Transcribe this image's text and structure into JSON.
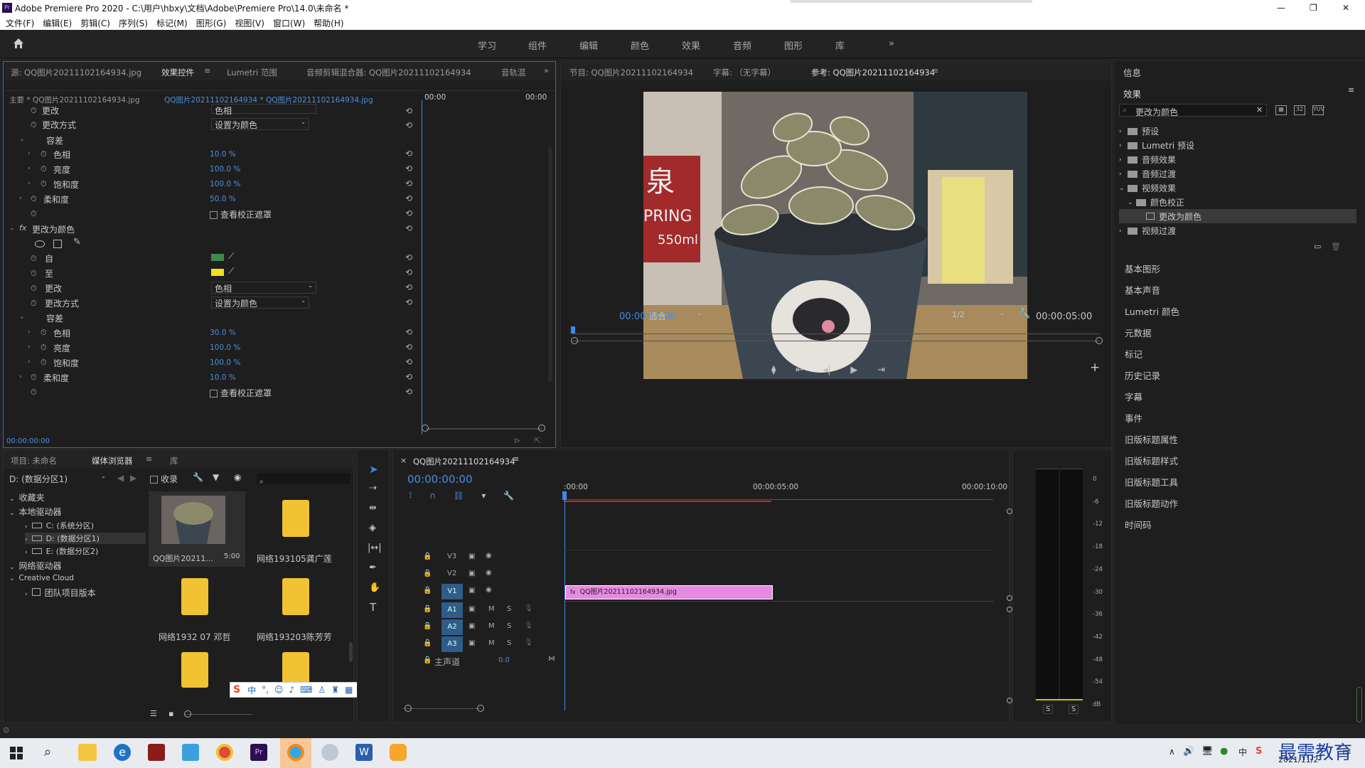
{
  "window": {
    "title": "Adobe Premiere Pro 2020 - C:\\用户\\hbxy\\文档\\Adobe\\Premiere Pro\\14.0\\未命名 *",
    "minimize": "—",
    "restore": "❐",
    "close": "✕"
  },
  "menu": [
    "文件(F)",
    "编辑(E)",
    "剪辑(C)",
    "序列(S)",
    "标记(M)",
    "图形(G)",
    "视图(V)",
    "窗口(W)",
    "帮助(H)"
  ],
  "workspaces": [
    "学习",
    "组件",
    "编辑",
    "颜色",
    "效果",
    "音频",
    "图形",
    "库"
  ],
  "workspace_more": "»",
  "effect_controls": {
    "tabs": [
      "源: QQ图片20211102164934.jpg",
      "效果控件",
      "Lumetri 范围",
      "音频剪辑混合器: QQ图片20211102164934",
      "音轨混"
    ],
    "master_label": "主要 * QQ图片20211102164934.jpg",
    "clip_label": "QQ图片20211102164934 * QQ图片20211102164934.jpg",
    "tl_start": "00:00",
    "tl_end": "00:00",
    "rows1": {
      "change_label": "更改",
      "change_value": "色相",
      "change_by_label": "更改方式",
      "change_by_value": "设置为颜色",
      "tolerance_label": "容差",
      "hue_label": "色相",
      "hue_value": "10.0 %",
      "lightness_label": "亮度",
      "lightness_value": "100.0 %",
      "saturation_label": "饱和度",
      "saturation_value": "100.0 %",
      "softness_label": "柔和度",
      "softness_value": "50.0 %",
      "mask_label": "查看校正遮罩"
    },
    "effect2_name": "更改为颜色",
    "rows2": {
      "from_label": "自",
      "to_label": "至",
      "change_label": "更改",
      "change_value": "色相",
      "change_by_label": "更改方式",
      "change_by_value": "设置为颜色",
      "tolerance_label": "容差",
      "hue_label": "色相",
      "hue_value": "30.0 %",
      "lightness_label": "亮度",
      "lightness_value": "100.0 %",
      "saturation_label": "饱和度",
      "saturation_value": "100.0 %",
      "softness_label": "柔和度",
      "softness_value": "10.0 %",
      "mask_label": "查看校正遮罩"
    },
    "timecode": "00:00:00:00"
  },
  "program": {
    "tabs": [
      "节目: QQ图片20211102164934",
      "字幕: （无字幕）",
      "参考: QQ图片20211102164934"
    ],
    "timecode": "00:00:00:00",
    "fit": "适合",
    "resolution": "1/2",
    "duration": "00:00:05:00"
  },
  "right": {
    "info": "信息",
    "effects": "效果",
    "search": "更改为颜色",
    "tree": [
      "预设",
      "Lumetri 预设",
      "音频效果",
      "音频过渡",
      "视频效果",
      "颜色校正",
      "更改为颜色",
      "视频过渡"
    ],
    "panels": [
      "基本图形",
      "基本声音",
      "Lumetri 颜色",
      "元数据",
      "标记",
      "历史记录",
      "字幕",
      "事件",
      "旧版标题属性",
      "旧版标题样式",
      "旧版标题工具",
      "旧版标题动作",
      "时间码"
    ]
  },
  "project": {
    "tabs": [
      "项目: 未命名",
      "媒体浏览器",
      "库"
    ],
    "drive": "D: (数据分区1)",
    "ingest": "收录",
    "tree": [
      "收藏夹",
      "本地驱动器",
      "C: (系统分区)",
      "D: (数据分区1)",
      "E: (数据分区2)",
      "网络驱动器",
      "Creative Cloud",
      "团队项目版本"
    ],
    "items": [
      {
        "name": "QQ图片20211...",
        "dur": "5:00"
      },
      {
        "name": "网络193105龚广莲",
        "dur": ""
      },
      {
        "name": "网络1932 07 邓哲",
        "dur": ""
      },
      {
        "name": "网络193203陈芳芳",
        "dur": ""
      }
    ]
  },
  "timeline": {
    "tab": "QQ图片20211102164934",
    "timecode": "00:00:00:00",
    "ruler": [
      ":00:00",
      "00:00:05:00",
      "00:00:10:00"
    ],
    "tracks_v": [
      "V3",
      "V2",
      "V1"
    ],
    "tracks_a": [
      "A1",
      "A2",
      "A3"
    ],
    "master": "主声道",
    "master_val": "0.0",
    "clip": "QQ图片20211102164934.jpg"
  },
  "meter": {
    "scale": [
      "0",
      "-6",
      "-12",
      "-18",
      "-24",
      "-30",
      "-36",
      "-42",
      "-48",
      "-54",
      "dB"
    ],
    "solo": [
      "S",
      "S"
    ]
  },
  "ime": {
    "lang": "中",
    "punct": "°,"
  },
  "taskbar": {
    "date": "2021/11/2"
  },
  "watermark": "最需教育",
  "colors": {
    "accent": "#2d8ceb",
    "from_swatch": "#3e8a4a",
    "to_swatch": "#f0e020",
    "clip": "#e58ae0"
  }
}
